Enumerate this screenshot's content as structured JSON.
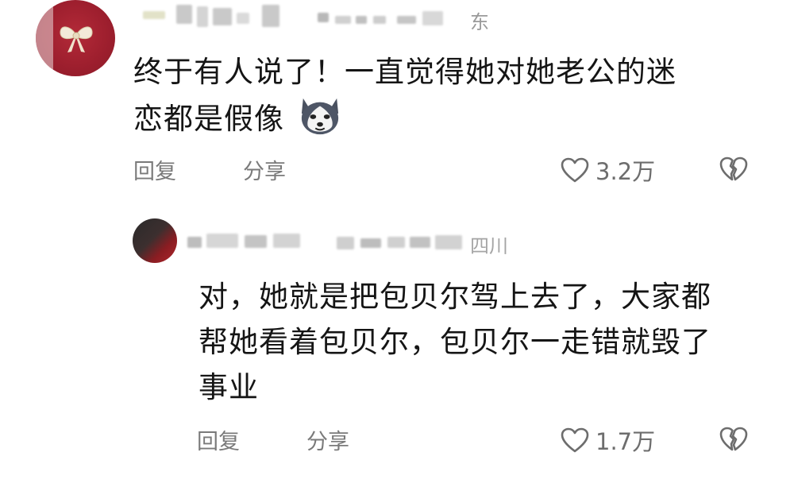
{
  "comments": [
    {
      "author_location": "东",
      "text_line1": "终于有人说了！一直觉得她对她老公的迷",
      "text_line2": "恋都是假像",
      "emoji": "husky-dog-icon",
      "reply_label": "回复",
      "share_label": "分享",
      "likes": "3.2万"
    }
  ],
  "reply": {
    "author_location": "四川",
    "text_line1": "对，她就是把包贝尔驾上去了，大家都",
    "text_line2": "帮她看着包贝尔，包贝尔一走错就毁了",
    "text_line3": "事业",
    "reply_label": "回复",
    "share_label": "分享",
    "likes": "1.7万"
  },
  "colors": {
    "text": "#151515",
    "meta": "#7a7a7a",
    "avatar_red": "#9e1f2e"
  }
}
